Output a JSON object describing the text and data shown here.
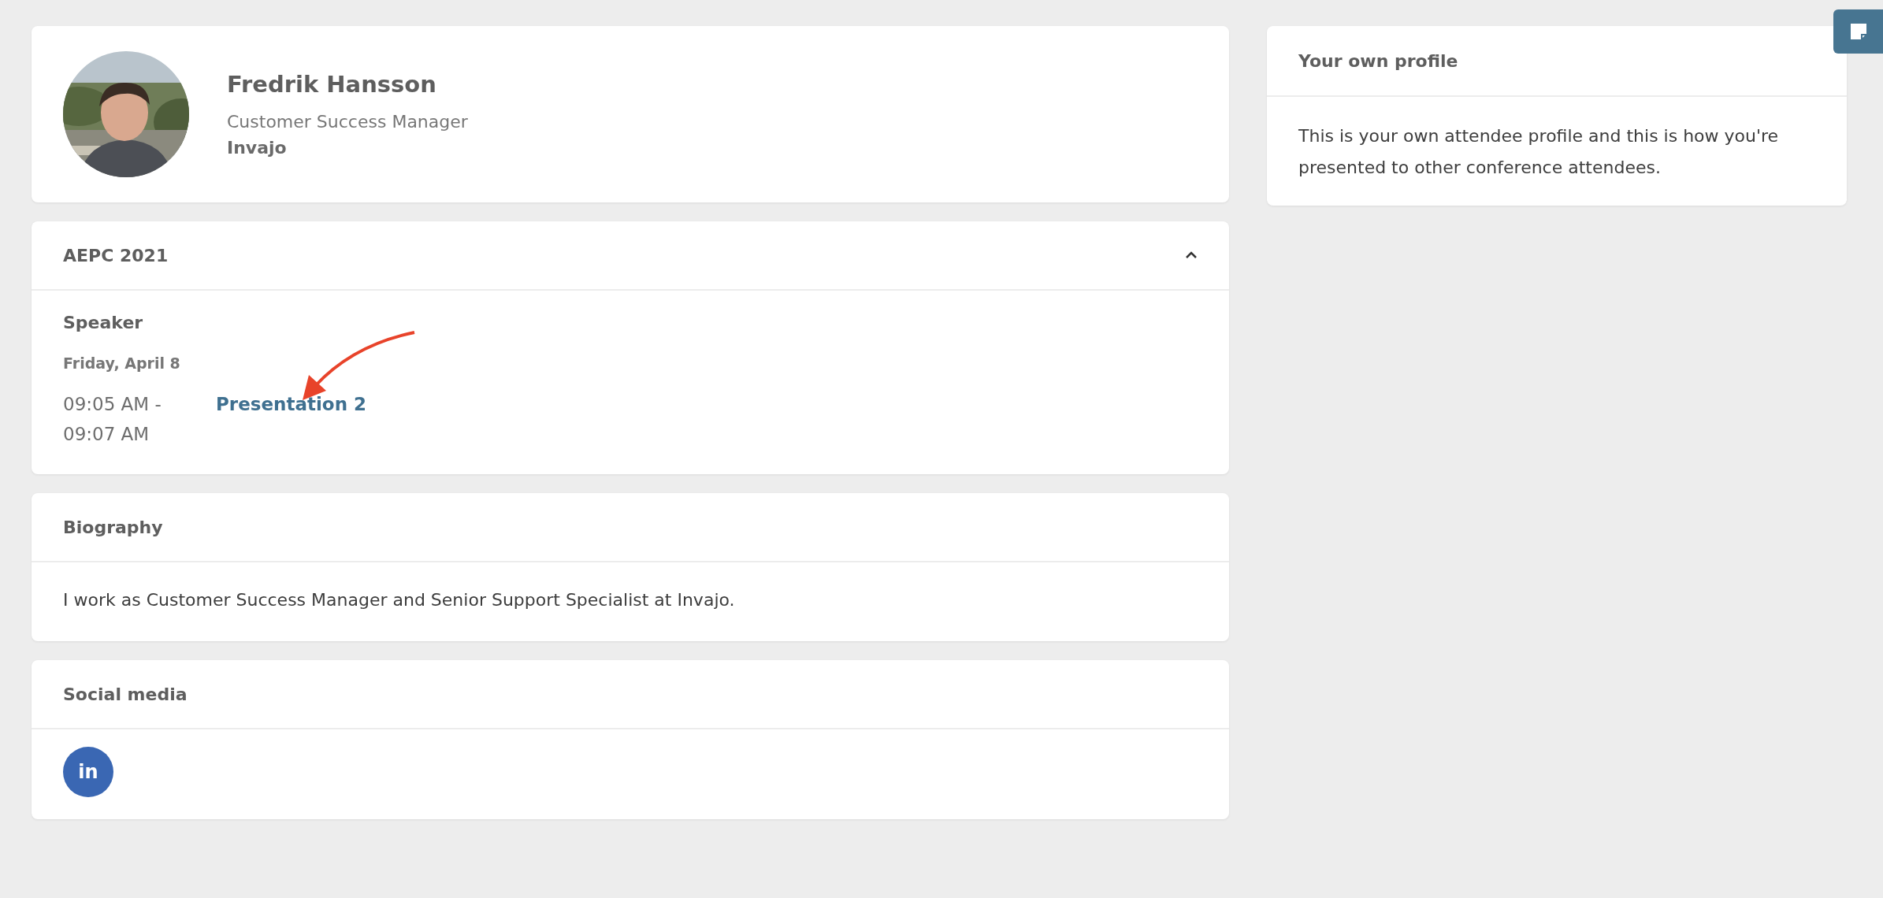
{
  "profile": {
    "name": "Fredrik Hansson",
    "title": "Customer Success Manager",
    "company": "Invajo"
  },
  "event": {
    "title": "AEPC 2021",
    "expanded": true,
    "role": "Speaker",
    "date": "Friday, April 8",
    "sessions": [
      {
        "start": "09:05 AM -",
        "end": "09:07 AM",
        "title": "Presentation 2"
      }
    ]
  },
  "biography": {
    "title": "Biography",
    "text": "I work as Customer Success Manager and Senior Support Specialist at Invajo."
  },
  "social": {
    "title": "Social media",
    "links": [
      {
        "label": "in",
        "color": "#3a67b3"
      }
    ]
  },
  "own_profile": {
    "title": "Your own profile",
    "text": "This is your own attendee profile and this is how you're presented to other conference attendees."
  }
}
